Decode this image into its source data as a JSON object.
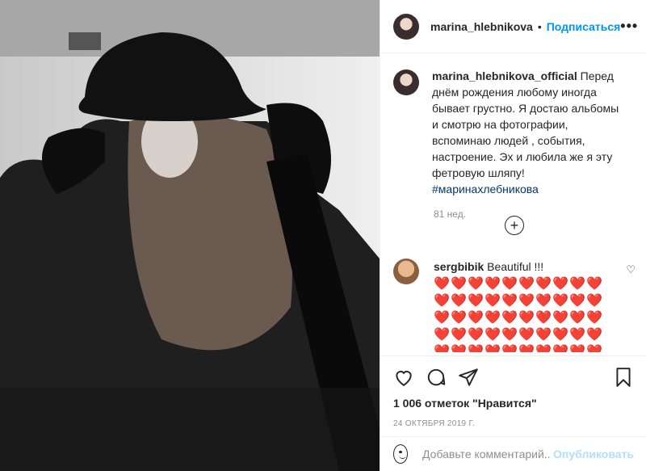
{
  "post": {
    "author": "marina_hlebnikova",
    "separator": "•",
    "follow_label": "Подписаться",
    "more_label": "•••"
  },
  "caption": {
    "username": "marina_hlebnikova_official",
    "text": "Перед днём рождения любому иногда бывает грустно. Я достаю альбомы и смотрю на фотографии, вспоминаю людей , события, настроение. Эх и любила же я эту фетровую шляпу!",
    "hashtag": "#маринахлебникова",
    "time": "81 нед."
  },
  "load_more": "+",
  "comment": {
    "username": "sergbibik",
    "text": "Beautiful !!!",
    "hearts": "❤️",
    "like_icon": "♡"
  },
  "likes_text": "1 006 отметок \"Нравится\"",
  "date_text": "24 ОКТЯБРЯ 2019 Г.",
  "add_comment": {
    "placeholder": "Добавьте комментарий...",
    "publish_label": "Опубликовать"
  },
  "icons": [
    "heart-icon",
    "comment-icon",
    "share-icon",
    "bookmark-icon",
    "emoji-icon",
    "add-circle-icon",
    "more-icon"
  ]
}
